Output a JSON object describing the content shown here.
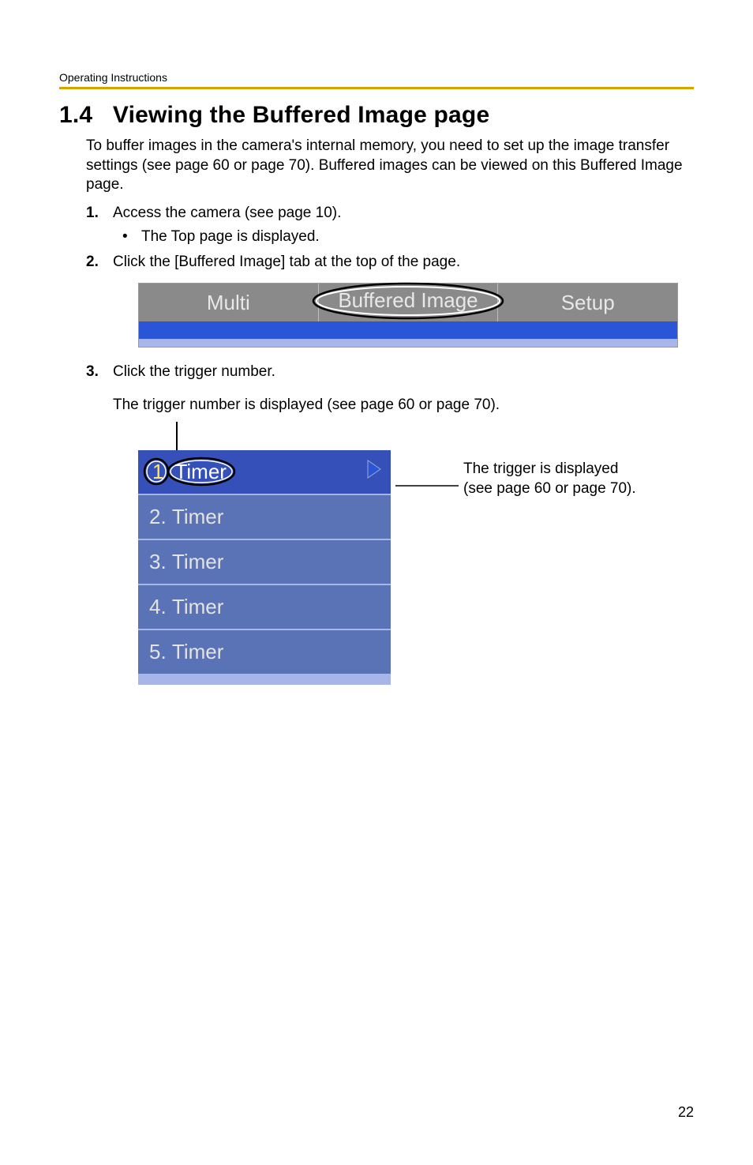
{
  "header": {
    "running": "Operating Instructions"
  },
  "section": {
    "number": "1.4",
    "title": "Viewing the Buffered Image page"
  },
  "intro": "To buffer images in the camera's internal memory, you need to set up the image transfer settings (see page 60 or page 70). Buffered images can be viewed on this Buffered Image page.",
  "steps": {
    "s1": {
      "num": "1.",
      "text": "Access the camera (see page 10)."
    },
    "s1bullet": "The Top page is displayed.",
    "s2": {
      "num": "2.",
      "text": "Click the [Buffered Image] tab at the top of the page."
    },
    "s3": {
      "num": "3.",
      "text": "Click the trigger number."
    },
    "s3note": "The trigger number is displayed (see page 60 or page 70)."
  },
  "tabs": {
    "left": "Multi",
    "center": "Buffered Image",
    "right": "Setup"
  },
  "triggers": {
    "items": [
      {
        "index": "1",
        "label": "Timer",
        "selected": true
      },
      {
        "index": "2.",
        "label": "Timer",
        "selected": false
      },
      {
        "index": "3.",
        "label": "Timer",
        "selected": false
      },
      {
        "index": "4.",
        "label": "Timer",
        "selected": false
      },
      {
        "index": "5.",
        "label": "Timer",
        "selected": false
      }
    ]
  },
  "callout": {
    "line1": "The trigger is displayed",
    "line2": "(see page 60 or page 70)."
  },
  "page_number": "22"
}
